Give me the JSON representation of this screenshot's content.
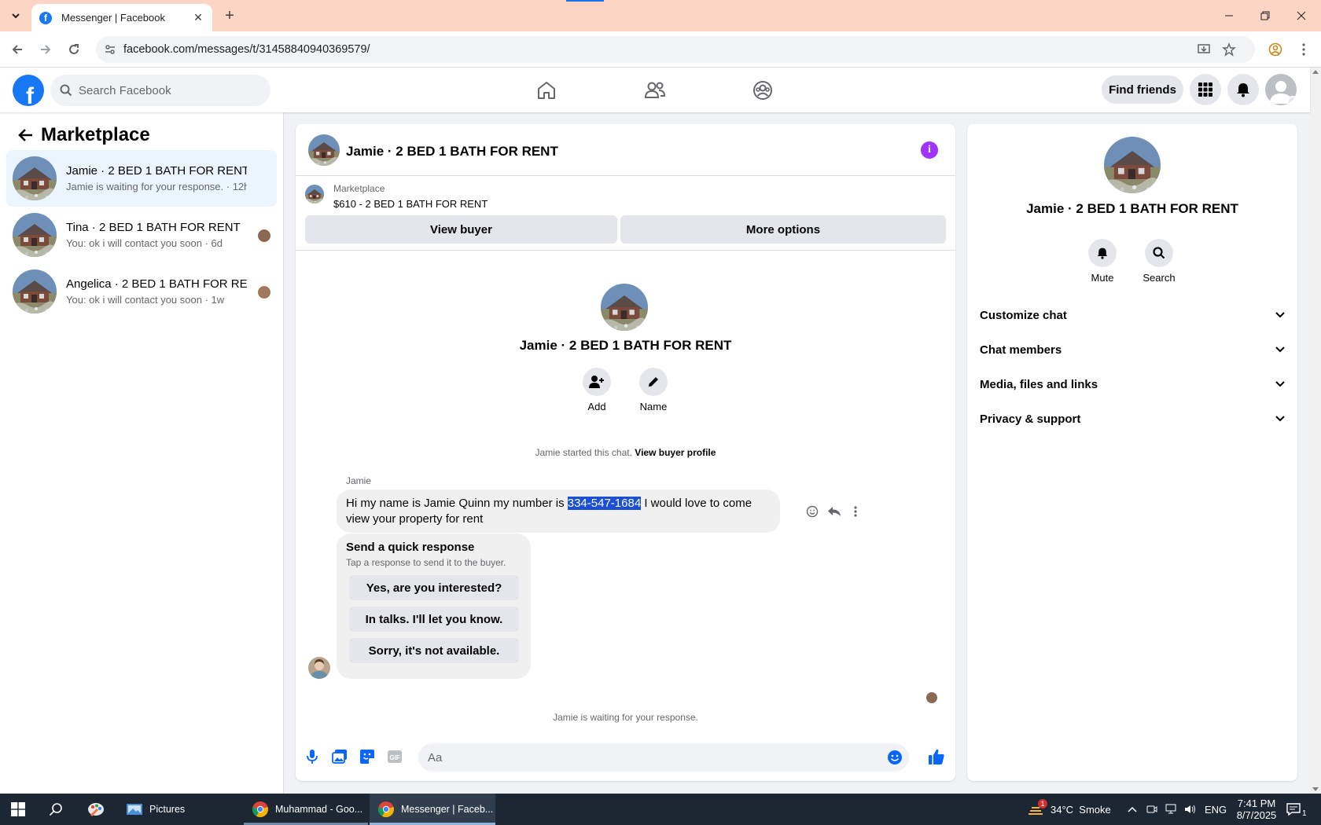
{
  "browser": {
    "tab_title": "Messenger | Facebook",
    "url": "facebook.com/messages/t/31458840940369579/"
  },
  "fb_header": {
    "search_placeholder": "Search Facebook",
    "find_friends_label": "Find friends",
    "nav_icons": [
      "home-icon",
      "friends-icon",
      "groups-icon"
    ],
    "brand_color": "#1877f2"
  },
  "sidebar": {
    "title": "Marketplace",
    "conversations": [
      {
        "name": "Jamie · 2 BED 1 BATH FOR RENT",
        "preview": "Jamie is waiting for your response. · 12h",
        "active": true
      },
      {
        "name": "Tina · 2 BED 1 BATH FOR RENT",
        "preview": "You: ok i will contact you soon · 6d",
        "active": false
      },
      {
        "name": "Angelica · 2 BED 1 BATH FOR RE...",
        "preview": "You: ok i will contact you soon · 1w",
        "active": false
      }
    ]
  },
  "chat": {
    "title": "Jamie · 2 BED 1 BATH FOR RENT",
    "marketplace_label": "Marketplace",
    "listing": "$610 - 2 BED 1 BATH FOR RENT",
    "view_buyer_label": "View buyer",
    "more_options_label": "More options",
    "intro_name": "Jamie · 2 BED 1 BATH FOR RENT",
    "add_label": "Add",
    "name_label": "Name",
    "started_text": "Jamie started this chat.",
    "view_profile_label": "View buyer profile",
    "sender": "Jamie",
    "message_before": "Hi my name is Jamie Quinn my number is ",
    "message_highlight": "334-547-1684",
    "message_after": " I would love to come view your property for rent",
    "quick_title": "Send a quick response",
    "quick_subtitle": "Tap a response to send it to the buyer.",
    "quick_responses": [
      "Yes, are you interested?",
      "In talks. I'll let you know.",
      "Sorry, it's not available."
    ],
    "waiting_text": "Jamie is waiting for your response.",
    "composer_placeholder": "Aa"
  },
  "right_panel": {
    "name": "Jamie · 2 BED 1 BATH FOR RENT",
    "mute_label": "Mute",
    "search_label": "Search",
    "sections": [
      "Customize chat",
      "Chat members",
      "Media, files and links",
      "Privacy & support"
    ]
  },
  "taskbar": {
    "apps": [
      "Pictures",
      "Muhammad - Goo...",
      "Messenger | Faceb..."
    ],
    "weather": "34°C  Smoke",
    "weather_badge": "1",
    "language": "ENG",
    "time": "7:41 PM",
    "date": "8/7/2025",
    "notification_count": "1"
  }
}
